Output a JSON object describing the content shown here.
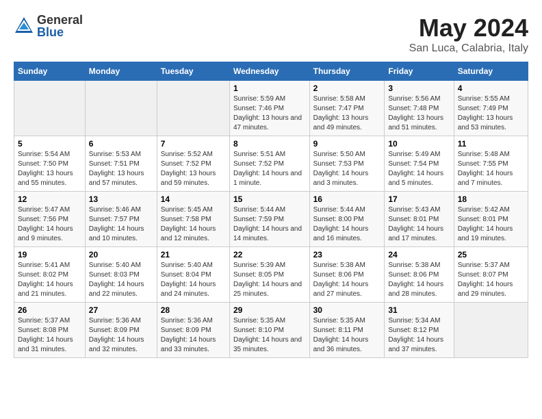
{
  "header": {
    "logo_general": "General",
    "logo_blue": "Blue",
    "month_year": "May 2024",
    "location": "San Luca, Calabria, Italy"
  },
  "days_of_week": [
    "Sunday",
    "Monday",
    "Tuesday",
    "Wednesday",
    "Thursday",
    "Friday",
    "Saturday"
  ],
  "weeks": [
    [
      {
        "num": "",
        "sunrise": "",
        "sunset": "",
        "daylight": "",
        "empty": true
      },
      {
        "num": "",
        "sunrise": "",
        "sunset": "",
        "daylight": "",
        "empty": true
      },
      {
        "num": "",
        "sunrise": "",
        "sunset": "",
        "daylight": "",
        "empty": true
      },
      {
        "num": "1",
        "sunrise": "Sunrise: 5:59 AM",
        "sunset": "Sunset: 7:46 PM",
        "daylight": "Daylight: 13 hours and 47 minutes."
      },
      {
        "num": "2",
        "sunrise": "Sunrise: 5:58 AM",
        "sunset": "Sunset: 7:47 PM",
        "daylight": "Daylight: 13 hours and 49 minutes."
      },
      {
        "num": "3",
        "sunrise": "Sunrise: 5:56 AM",
        "sunset": "Sunset: 7:48 PM",
        "daylight": "Daylight: 13 hours and 51 minutes."
      },
      {
        "num": "4",
        "sunrise": "Sunrise: 5:55 AM",
        "sunset": "Sunset: 7:49 PM",
        "daylight": "Daylight: 13 hours and 53 minutes."
      }
    ],
    [
      {
        "num": "5",
        "sunrise": "Sunrise: 5:54 AM",
        "sunset": "Sunset: 7:50 PM",
        "daylight": "Daylight: 13 hours and 55 minutes."
      },
      {
        "num": "6",
        "sunrise": "Sunrise: 5:53 AM",
        "sunset": "Sunset: 7:51 PM",
        "daylight": "Daylight: 13 hours and 57 minutes."
      },
      {
        "num": "7",
        "sunrise": "Sunrise: 5:52 AM",
        "sunset": "Sunset: 7:52 PM",
        "daylight": "Daylight: 13 hours and 59 minutes."
      },
      {
        "num": "8",
        "sunrise": "Sunrise: 5:51 AM",
        "sunset": "Sunset: 7:52 PM",
        "daylight": "Daylight: 14 hours and 1 minute."
      },
      {
        "num": "9",
        "sunrise": "Sunrise: 5:50 AM",
        "sunset": "Sunset: 7:53 PM",
        "daylight": "Daylight: 14 hours and 3 minutes."
      },
      {
        "num": "10",
        "sunrise": "Sunrise: 5:49 AM",
        "sunset": "Sunset: 7:54 PM",
        "daylight": "Daylight: 14 hours and 5 minutes."
      },
      {
        "num": "11",
        "sunrise": "Sunrise: 5:48 AM",
        "sunset": "Sunset: 7:55 PM",
        "daylight": "Daylight: 14 hours and 7 minutes."
      }
    ],
    [
      {
        "num": "12",
        "sunrise": "Sunrise: 5:47 AM",
        "sunset": "Sunset: 7:56 PM",
        "daylight": "Daylight: 14 hours and 9 minutes."
      },
      {
        "num": "13",
        "sunrise": "Sunrise: 5:46 AM",
        "sunset": "Sunset: 7:57 PM",
        "daylight": "Daylight: 14 hours and 10 minutes."
      },
      {
        "num": "14",
        "sunrise": "Sunrise: 5:45 AM",
        "sunset": "Sunset: 7:58 PM",
        "daylight": "Daylight: 14 hours and 12 minutes."
      },
      {
        "num": "15",
        "sunrise": "Sunrise: 5:44 AM",
        "sunset": "Sunset: 7:59 PM",
        "daylight": "Daylight: 14 hours and 14 minutes."
      },
      {
        "num": "16",
        "sunrise": "Sunrise: 5:44 AM",
        "sunset": "Sunset: 8:00 PM",
        "daylight": "Daylight: 14 hours and 16 minutes."
      },
      {
        "num": "17",
        "sunrise": "Sunrise: 5:43 AM",
        "sunset": "Sunset: 8:01 PM",
        "daylight": "Daylight: 14 hours and 17 minutes."
      },
      {
        "num": "18",
        "sunrise": "Sunrise: 5:42 AM",
        "sunset": "Sunset: 8:01 PM",
        "daylight": "Daylight: 14 hours and 19 minutes."
      }
    ],
    [
      {
        "num": "19",
        "sunrise": "Sunrise: 5:41 AM",
        "sunset": "Sunset: 8:02 PM",
        "daylight": "Daylight: 14 hours and 21 minutes."
      },
      {
        "num": "20",
        "sunrise": "Sunrise: 5:40 AM",
        "sunset": "Sunset: 8:03 PM",
        "daylight": "Daylight: 14 hours and 22 minutes."
      },
      {
        "num": "21",
        "sunrise": "Sunrise: 5:40 AM",
        "sunset": "Sunset: 8:04 PM",
        "daylight": "Daylight: 14 hours and 24 minutes."
      },
      {
        "num": "22",
        "sunrise": "Sunrise: 5:39 AM",
        "sunset": "Sunset: 8:05 PM",
        "daylight": "Daylight: 14 hours and 25 minutes."
      },
      {
        "num": "23",
        "sunrise": "Sunrise: 5:38 AM",
        "sunset": "Sunset: 8:06 PM",
        "daylight": "Daylight: 14 hours and 27 minutes."
      },
      {
        "num": "24",
        "sunrise": "Sunrise: 5:38 AM",
        "sunset": "Sunset: 8:06 PM",
        "daylight": "Daylight: 14 hours and 28 minutes."
      },
      {
        "num": "25",
        "sunrise": "Sunrise: 5:37 AM",
        "sunset": "Sunset: 8:07 PM",
        "daylight": "Daylight: 14 hours and 29 minutes."
      }
    ],
    [
      {
        "num": "26",
        "sunrise": "Sunrise: 5:37 AM",
        "sunset": "Sunset: 8:08 PM",
        "daylight": "Daylight: 14 hours and 31 minutes."
      },
      {
        "num": "27",
        "sunrise": "Sunrise: 5:36 AM",
        "sunset": "Sunset: 8:09 PM",
        "daylight": "Daylight: 14 hours and 32 minutes."
      },
      {
        "num": "28",
        "sunrise": "Sunrise: 5:36 AM",
        "sunset": "Sunset: 8:09 PM",
        "daylight": "Daylight: 14 hours and 33 minutes."
      },
      {
        "num": "29",
        "sunrise": "Sunrise: 5:35 AM",
        "sunset": "Sunset: 8:10 PM",
        "daylight": "Daylight: 14 hours and 35 minutes."
      },
      {
        "num": "30",
        "sunrise": "Sunrise: 5:35 AM",
        "sunset": "Sunset: 8:11 PM",
        "daylight": "Daylight: 14 hours and 36 minutes."
      },
      {
        "num": "31",
        "sunrise": "Sunrise: 5:34 AM",
        "sunset": "Sunset: 8:12 PM",
        "daylight": "Daylight: 14 hours and 37 minutes."
      },
      {
        "num": "",
        "sunrise": "",
        "sunset": "",
        "daylight": "",
        "empty": true
      }
    ]
  ]
}
